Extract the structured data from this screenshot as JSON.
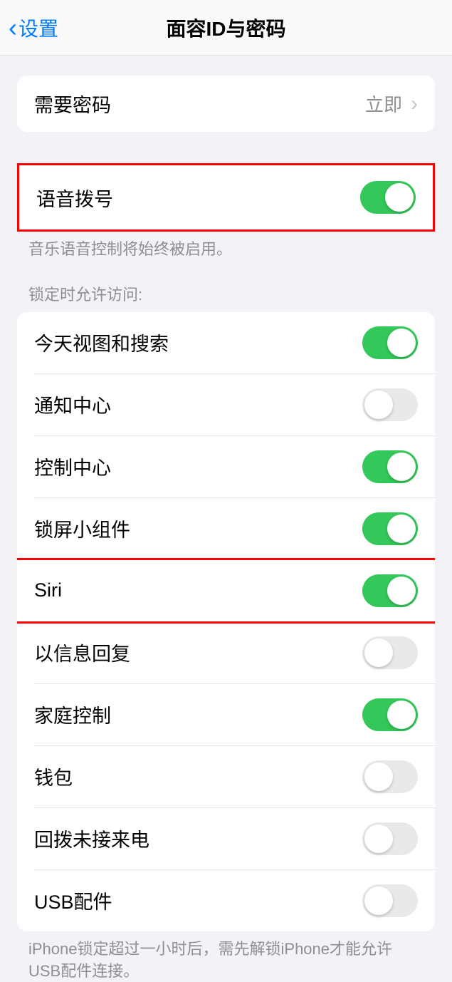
{
  "header": {
    "back_label": "设置",
    "title": "面容ID与密码"
  },
  "passcode_section": {
    "require_passcode_label": "需要密码",
    "require_passcode_value": "立即"
  },
  "voice_dial_section": {
    "voice_dial_label": "语音拨号",
    "voice_dial_on": true,
    "voice_dial_footer": "音乐语音控制将始终被启用。"
  },
  "lock_access_header": "锁定时允许访问:",
  "lock_access_items": [
    {
      "label": "今天视图和搜索",
      "on": true
    },
    {
      "label": "通知中心",
      "on": false
    },
    {
      "label": "控制中心",
      "on": true
    },
    {
      "label": "锁屏小组件",
      "on": true
    },
    {
      "label": "Siri",
      "on": true
    },
    {
      "label": "以信息回复",
      "on": false
    },
    {
      "label": "家庭控制",
      "on": true
    },
    {
      "label": "钱包",
      "on": false
    },
    {
      "label": "回拨未接来电",
      "on": false
    },
    {
      "label": "USB配件",
      "on": false
    }
  ],
  "usb_footer": "iPhone锁定超过一小时后，需先解锁iPhone才能允许USB配件连接。"
}
